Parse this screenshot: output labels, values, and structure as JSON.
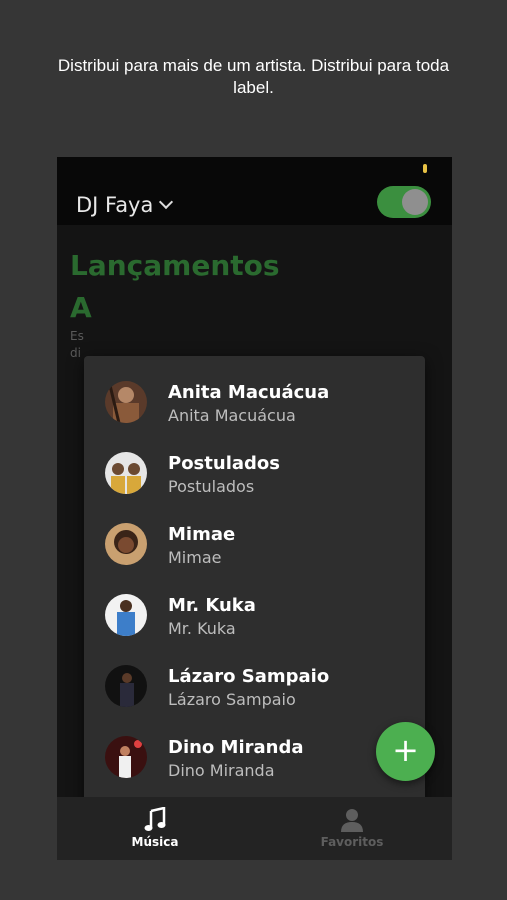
{
  "caption": "Distribui para mais de um artista. Distribui para toda label.",
  "header": {
    "account_name": "DJ Faya",
    "toggle_on": true
  },
  "main": {
    "title": "Lançamentos",
    "subtitle_letter": "A",
    "subtitle_text": "Es di"
  },
  "artists": [
    {
      "name": "Anita Macuácua",
      "subtitle": "Anita Macuácua"
    },
    {
      "name": "Postulados",
      "subtitle": "Postulados"
    },
    {
      "name": "Mimae",
      "subtitle": "Mimae"
    },
    {
      "name": "Mr. Kuka",
      "subtitle": "Mr. Kuka"
    },
    {
      "name": "Lázaro Sampaio",
      "subtitle": "Lázaro Sampaio"
    },
    {
      "name": "Dino Miranda",
      "subtitle": "Dino Miranda"
    }
  ],
  "fab": {
    "label": "+"
  },
  "bottom_nav": {
    "items": [
      {
        "label": "Música",
        "icon": "music-note-icon"
      },
      {
        "label": "Favoritos",
        "icon": "person-icon"
      }
    ]
  },
  "colors": {
    "accent": "#4caf50",
    "background": "#363636",
    "menu": "#2e2e2e"
  }
}
